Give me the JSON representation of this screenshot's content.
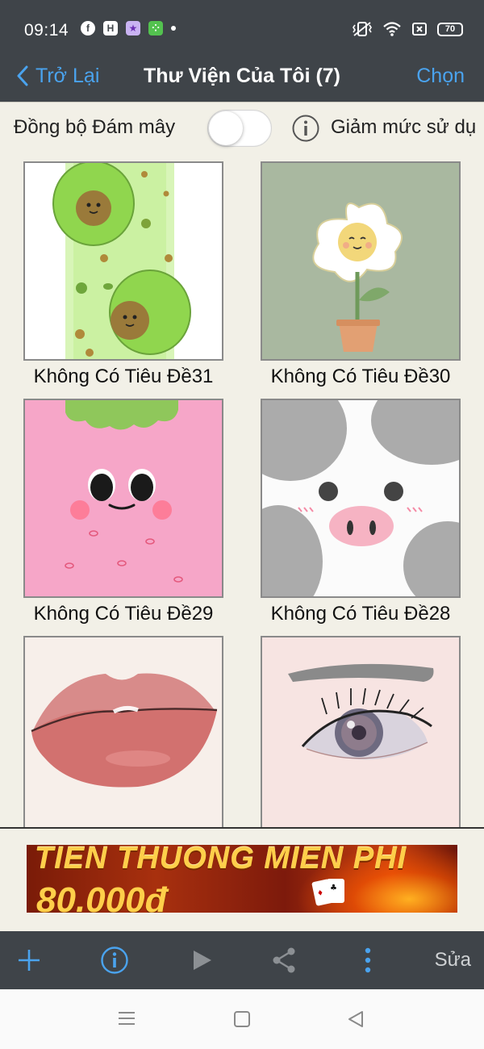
{
  "status_bar": {
    "time": "09:14",
    "battery": "70",
    "left_icons": [
      "facebook-icon",
      "h-app-icon",
      "game-app-icon",
      "green-app-icon",
      "notification-dot"
    ],
    "right_icons": [
      "vibrate-icon",
      "wifi-icon",
      "box-icon",
      "battery-icon"
    ]
  },
  "nav": {
    "back_label": "Trở Lại",
    "title": "Thư Viện Của Tôi (7)",
    "select_label": "Chọn",
    "accent_color": "#4aa3ee"
  },
  "sync": {
    "label": "Đồng bộ Đám mây",
    "toggle_on": false,
    "reduce_label": "Giảm mức sử dụ"
  },
  "gallery": {
    "items": [
      {
        "title": "Không Có Tiêu Đề31",
        "image": "avocado-drawing"
      },
      {
        "title": "Không Có Tiêu Đề30",
        "image": "flower-drawing"
      },
      {
        "title": "Không Có Tiêu Đề29",
        "image": "strawberry-face-drawing"
      },
      {
        "title": "Không Có Tiêu Đề28",
        "image": "pig-drawing"
      },
      {
        "title": "",
        "image": "lips-drawing"
      },
      {
        "title": "",
        "image": "eye-drawing"
      }
    ]
  },
  "ad": {
    "line1": "TIEN THUONG MIEN PHI",
    "line2": "80.000đ"
  },
  "toolbar": {
    "items": [
      "add-icon",
      "info-icon",
      "play-icon",
      "share-icon",
      "more-icon"
    ],
    "edit_label": "Sửa"
  },
  "system_nav": [
    "menu-icon",
    "home-icon",
    "back-icon"
  ]
}
